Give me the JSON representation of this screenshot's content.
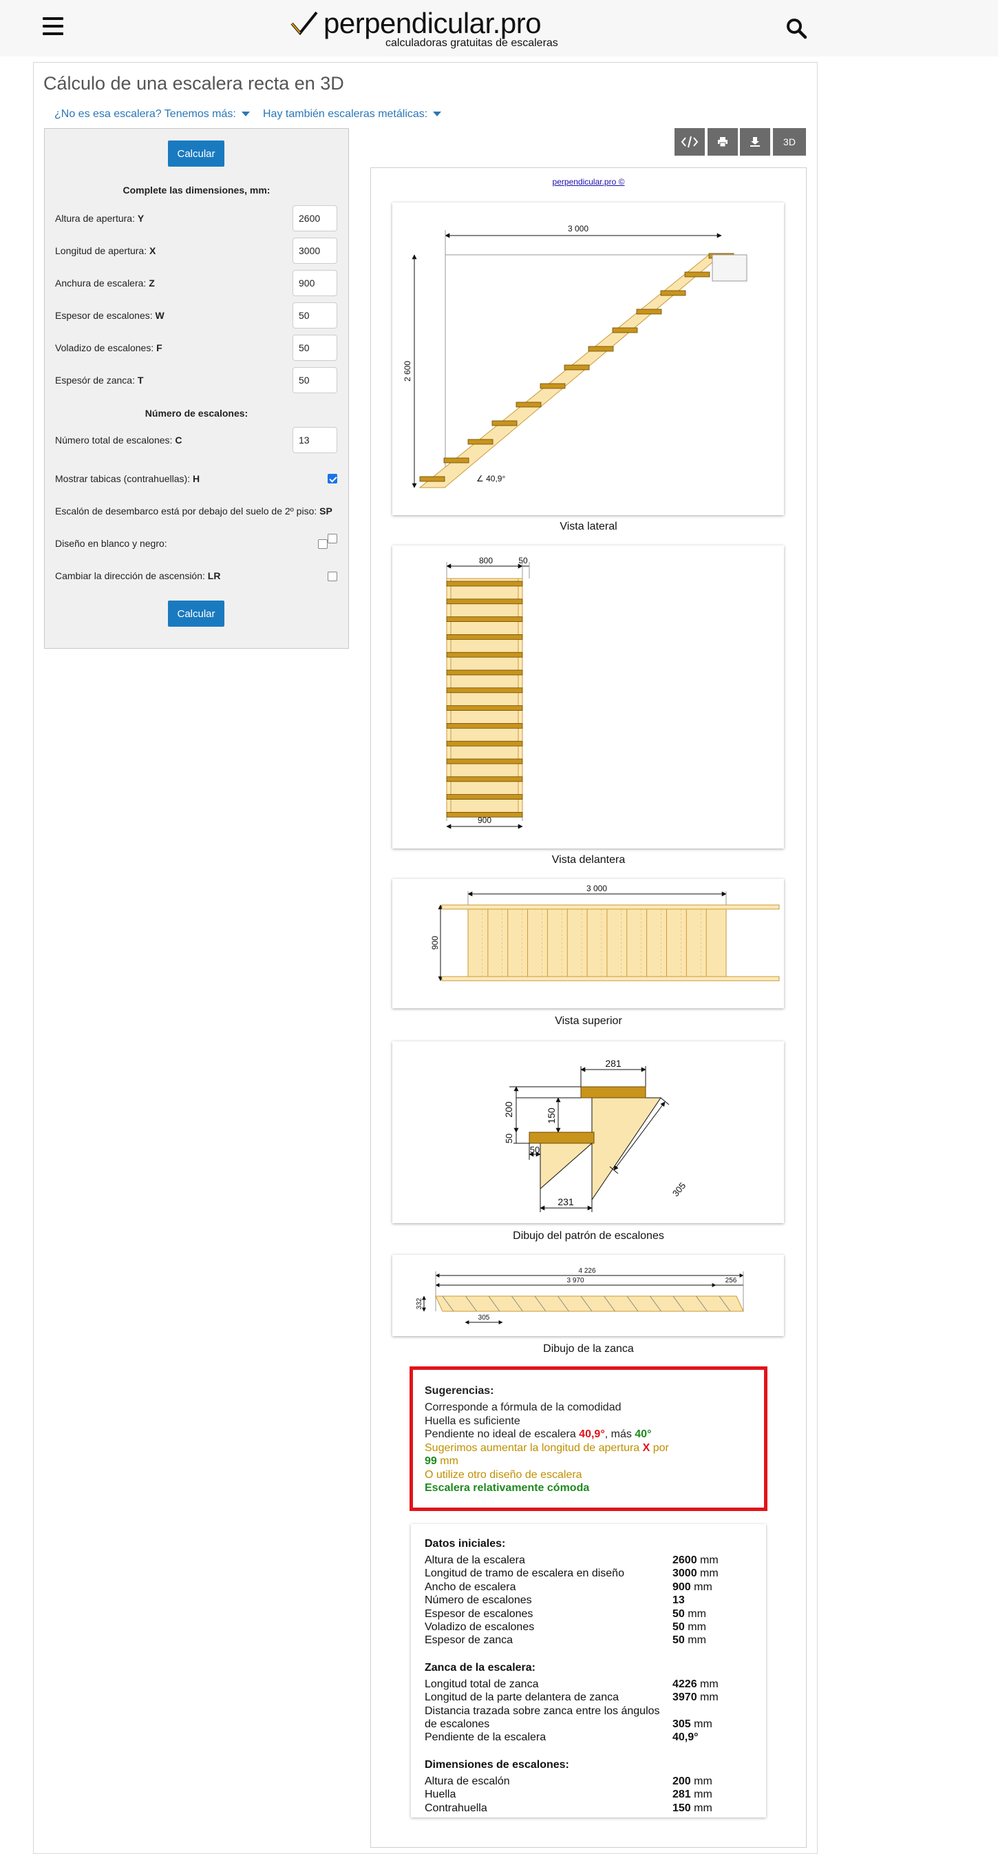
{
  "header": {
    "logo_text": "perpendicular.pro",
    "logo_sub": "calculadoras gratuitas de escaleras"
  },
  "page": {
    "title": "Cálculo de una escalera recta en 3D",
    "dropdown1": "¿No es esa escalera? Tenemos más:",
    "dropdown2": "Hay también escaleras metálicas:"
  },
  "form": {
    "calc_label": "Calcular",
    "dims_heading": "Complete las dimensiones, mm:",
    "fields": [
      {
        "label": "Altura de apertura: ",
        "key": "Y",
        "value": "2600"
      },
      {
        "label": "Longitud de apertura: ",
        "key": "X",
        "value": "3000"
      },
      {
        "label": "Anchura de escalera: ",
        "key": "Z",
        "value": "900"
      },
      {
        "label": "Espesor de escalones: ",
        "key": "W",
        "value": "50"
      },
      {
        "label": "Voladizo de escalones: ",
        "key": "F",
        "value": "50"
      },
      {
        "label": "Espesór de zanca: ",
        "key": "T",
        "value": "50"
      }
    ],
    "steps_heading": "Número de escalones:",
    "steps_field": {
      "label": "Número total de escalones: ",
      "key": "C",
      "value": "13"
    },
    "options": [
      {
        "label": "Mostrar tabicas (contrahuellas): ",
        "key": "H",
        "checked": true
      },
      {
        "label": "Escalón de desembarco está por debajo del suelo de 2º piso: ",
        "key": "SP",
        "checked": false
      },
      {
        "label": "Diseño en blanco y negro:",
        "key": "",
        "checked": false
      },
      {
        "label": "Cambiar la dirección de ascensión: ",
        "key": "LR",
        "checked": false
      }
    ]
  },
  "toolbar": {
    "code": "</>",
    "print": "print",
    "download": "download",
    "three_d": "3D"
  },
  "credit": "perpendicular.pro ©",
  "drawings": {
    "lateral": {
      "caption": "Vista lateral",
      "width_label": "3 000",
      "height_label": "2 600",
      "angle_label": "∠ 40,9°"
    },
    "front": {
      "caption": "Vista delantera",
      "top1": "800",
      "top2": "50",
      "bottom": "900"
    },
    "top": {
      "caption": "Vista superior",
      "length": "3 000",
      "width": "900"
    },
    "pattern": {
      "caption": "Dibujo del patrón de escalones",
      "tread": "281",
      "h200": "200",
      "h150": "150",
      "h50a": "50",
      "h50b": "50",
      "run": "231",
      "diag": "305"
    },
    "stringer": {
      "caption": "Dibujo de la zanca",
      "total": "4 226",
      "front": "3 970",
      "end": "256",
      "height": "332",
      "step": "305"
    }
  },
  "suggestions": {
    "heading": "Sugerencias:",
    "l1": "Corresponde a fórmula de la comodidad",
    "l2": "Huella es suficiente",
    "l3a": "Pendiente no ideal de escalera ",
    "l3b": "40,9°",
    "l3c": ", más ",
    "l3d": "40°",
    "l4a": "Sugerimos aumentar la longitud de apertura ",
    "l4b": "X",
    "l4c": " por",
    "l5a": "99",
    "l5b": " mm",
    "l6": "O utilize otro diseño de escalera",
    "l7": "Escalera relativamente cómoda"
  },
  "data": {
    "sections": [
      {
        "heading": "Datos iniciales:",
        "rows": [
          {
            "label": "Altura de la escalera",
            "value": "2600",
            "unit": " mm"
          },
          {
            "label": "Longitud de tramo de escalera en diseño",
            "value": "3000",
            "unit": " mm"
          },
          {
            "label": "Ancho de escalera",
            "value": "900",
            "unit": " mm"
          },
          {
            "label": "Número de escalones",
            "value": "13",
            "unit": ""
          },
          {
            "label": "Espesor de escalones",
            "value": "50",
            "unit": " mm"
          },
          {
            "label": "Voladizo de escalones",
            "value": "50",
            "unit": " mm"
          },
          {
            "label": "Espesor de zanca",
            "value": "50",
            "unit": " mm"
          }
        ]
      },
      {
        "heading": "Zanca de la escalera:",
        "rows": [
          {
            "label": "Longitud total de zanca",
            "value": "4226",
            "unit": " mm"
          },
          {
            "label": "Longitud de la parte delantera de zanca",
            "value": "3970",
            "unit": " mm"
          },
          {
            "label": "Distancia trazada sobre zanca entre los ángulos",
            "value": "",
            "unit": ""
          },
          {
            "label": "de escalones",
            "value": "305",
            "unit": " mm"
          },
          {
            "label": "Pendiente de la escalera",
            "value": "40,9°",
            "unit": ""
          }
        ]
      },
      {
        "heading": "Dimensiones de escalones:",
        "rows": [
          {
            "label": "Altura de escalón",
            "value": "200",
            "unit": " mm"
          },
          {
            "label": "Huella",
            "value": "281",
            "unit": " mm"
          },
          {
            "label": "Contrahuella",
            "value": "150",
            "unit": " mm"
          }
        ]
      }
    ]
  }
}
